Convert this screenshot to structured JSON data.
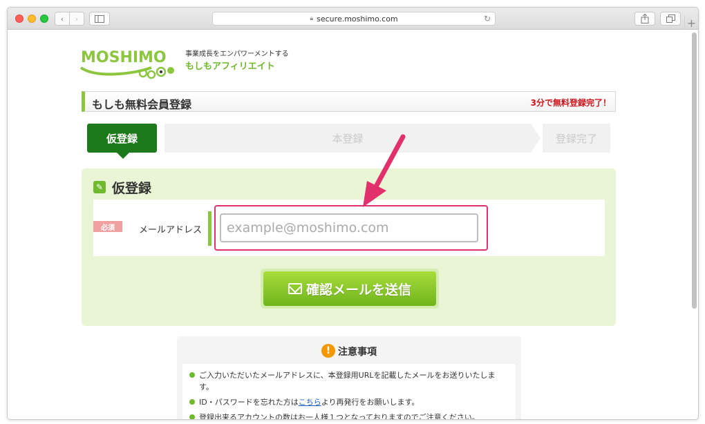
{
  "browser": {
    "url": "secure.moshimo.com"
  },
  "header": {
    "logo_text": "MOSHIMO",
    "tagline": "事業成長をエンパワーメントする",
    "brand": "もしもアフィリエイト"
  },
  "title_bar": {
    "title": "もしも無料会員登録",
    "promo": "3分で無料登録完了！"
  },
  "steps": [
    {
      "label": "仮登録",
      "active": true
    },
    {
      "label": "本登録",
      "active": false
    },
    {
      "label": "登録完了",
      "active": false
    }
  ],
  "form": {
    "heading": "仮登録",
    "required_badge": "必須",
    "email_label": "メールアドレス",
    "email_placeholder": "example@moshimo.com",
    "email_value": "",
    "submit_label": "確認メールを送信"
  },
  "notes": {
    "title": "注意事項",
    "items": [
      {
        "text": "ご入力いただいたメールアドレスに、本登録用URLを記載したメールをお送りいたします。"
      },
      {
        "before": "ID・パスワードを忘れた方は",
        "link": "こちら",
        "after": "より再発行をお願いします。"
      },
      {
        "text": "登録出来るアカウントの数はお一人様１つとなっておりますのでご注意ください。"
      }
    ]
  },
  "colors": {
    "brand_green": "#6fb92c",
    "step_active": "#1d7a1a",
    "panel_bg": "#e9f5d4",
    "promo_red": "#d0121b",
    "highlight_pink": "#e1306c",
    "notice_orange": "#f39800"
  },
  "icons": {
    "lock": "lock-icon",
    "reload": "reload-icon",
    "edit": "pencil-icon",
    "mail": "mail-icon",
    "notice": "exclamation-icon"
  }
}
